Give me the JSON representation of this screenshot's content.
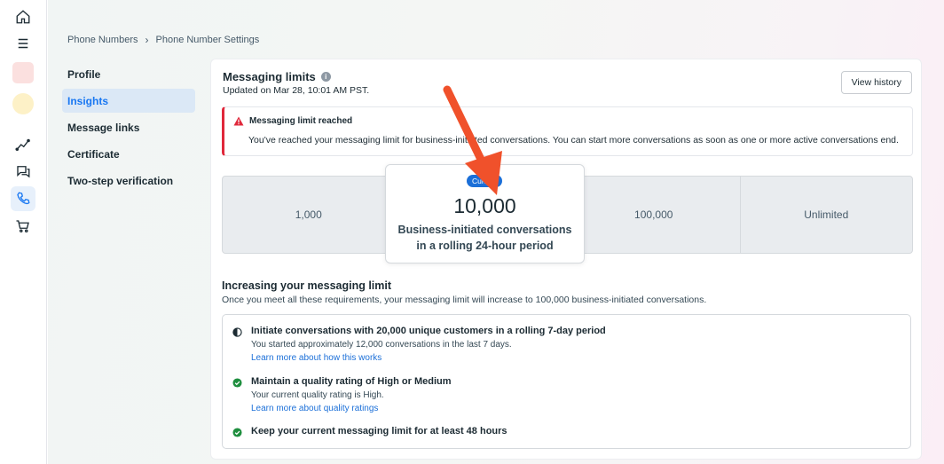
{
  "rail": {
    "items": [
      {
        "name": "home-icon"
      },
      {
        "name": "menu-icon"
      },
      {
        "name": "account-avatar"
      },
      {
        "name": "business-avatar"
      },
      {
        "name": "analytics-icon"
      },
      {
        "name": "chat-icon"
      },
      {
        "name": "phone-icon"
      },
      {
        "name": "cart-icon"
      }
    ]
  },
  "breadcrumb": {
    "parent": "Phone Numbers",
    "separator": "›",
    "current": "Phone Number Settings"
  },
  "subnav": {
    "profile": "Profile",
    "insights": "Insights",
    "message_links": "Message links",
    "certificate": "Certificate",
    "two_step": "Two-step verification"
  },
  "card": {
    "title": "Messaging limits",
    "info_icon": "i",
    "updated": "Updated on Mar 28, 10:01 AM PST.",
    "view_history": "View history",
    "alert": {
      "icon": "warning-icon",
      "title": "Messaging limit reached",
      "body": "You've reached your messaging limit for business-initiated conversations. You can start more conversations as soon as one or more active conversations end."
    },
    "tiers": {
      "t1": "1,000",
      "t3": "100,000",
      "t4": "Unlimited"
    },
    "current": {
      "badge": "Current",
      "value": "10,000",
      "desc_line1": "Business-initiated conversations",
      "desc_line2": "in a rolling 24-hour period"
    },
    "increase": {
      "title": "Increasing your messaging limit",
      "desc": "Once you meet all these requirements, your messaging limit will increase to 100,000 business-initiated conversations."
    },
    "requirements": {
      "r1": {
        "icon": "half-circle-progress-icon",
        "title": "Initiate conversations with 20,000 unique customers in a rolling 7-day period",
        "detail": "You started approximately 12,000 conversations in the last 7 days.",
        "link": "Learn more about how this works"
      },
      "r2": {
        "icon": "check-circle-icon",
        "title": "Maintain a quality rating of High or Medium",
        "detail": "Your current quality rating is High.",
        "link": "Learn more about quality ratings"
      },
      "r3": {
        "icon": "check-circle-icon",
        "title": "Keep your current messaging limit for at least 48 hours"
      }
    }
  },
  "colors": {
    "accent": "#1877f2",
    "alert_red": "#e0283b",
    "success_green": "#1e8e3e",
    "annotation_arrow": "#f0512b"
  }
}
